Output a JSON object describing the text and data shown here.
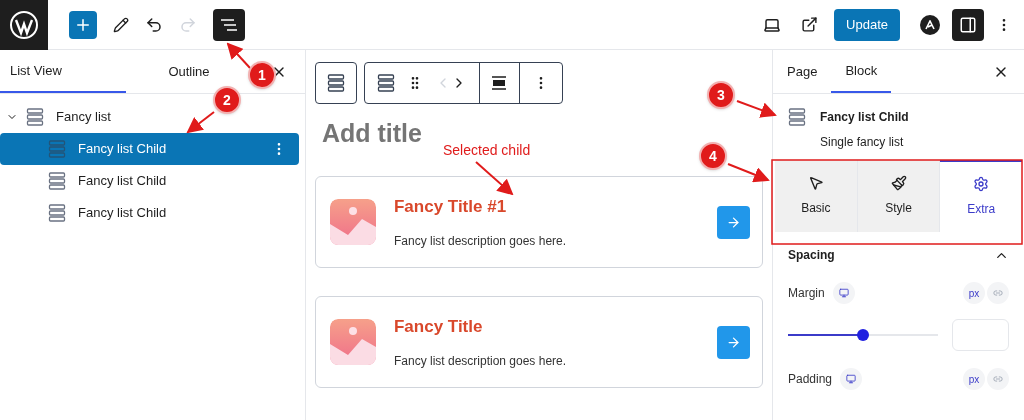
{
  "top_bar": {
    "update_button": "Update"
  },
  "list_view": {
    "tabs": [
      {
        "label": "List View",
        "selected": true
      },
      {
        "label": "Outline",
        "selected": false
      }
    ],
    "tree": [
      {
        "label": "Fancy list",
        "expanded": true,
        "children": [
          {
            "label": "Fancy list Child",
            "selected": true
          },
          {
            "label": "Fancy list Child",
            "selected": false
          },
          {
            "label": "Fancy list Child",
            "selected": false
          }
        ]
      }
    ]
  },
  "canvas": {
    "title": {
      "placeholder": "Add title"
    },
    "items": [
      {
        "title": "Fancy Title #1",
        "description": "Fancy list description goes here."
      },
      {
        "title": "Fancy Title",
        "description": "Fancy list description goes here."
      }
    ]
  },
  "sidebar": {
    "tabs": [
      {
        "label": "Page",
        "selected": false
      },
      {
        "label": "Block",
        "selected": true
      }
    ],
    "block": {
      "name": "Fancy list Child",
      "description": "Single fancy list"
    },
    "panel_tabs": [
      {
        "label": "Basic",
        "kind": "pointer",
        "selected": false
      },
      {
        "label": "Style",
        "kind": "brush",
        "selected": false
      },
      {
        "label": "Extra",
        "kind": "gear",
        "selected": true
      }
    ],
    "section": {
      "title": "Spacing",
      "expanded": true
    },
    "margin": {
      "label": "Margin",
      "unit": "px",
      "level": 0.5
    },
    "padding": {
      "label": "Padding",
      "unit": "px"
    }
  },
  "annotations": {
    "markers": [
      "1",
      "2",
      "3",
      "4"
    ],
    "callout": "Selected child"
  }
}
